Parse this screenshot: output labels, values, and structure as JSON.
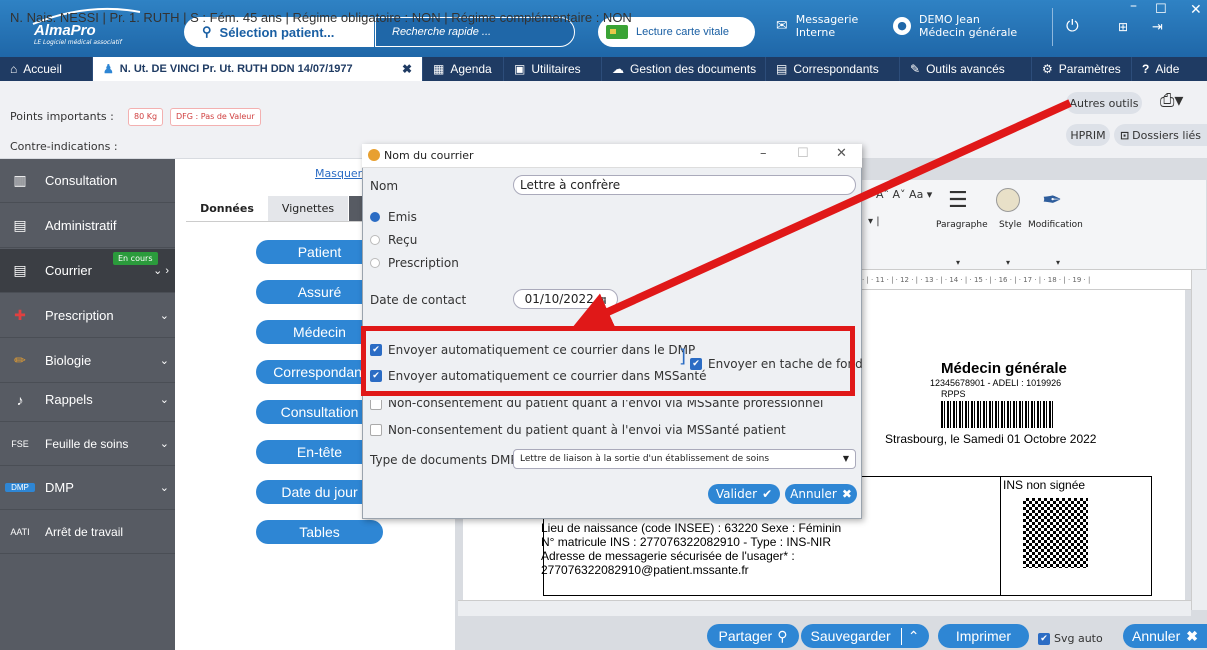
{
  "topbar": {
    "logo_text": "AlmaPro",
    "logo_sub": "LE Logiciel médical associatif",
    "select_patient": "Sélection patient...",
    "quick_search": "Recherche rapide ...",
    "carte_vitale": "Lecture carte vitale",
    "messagerie_1": "Messagerie",
    "messagerie_2": "Interne",
    "user_name": "DEMO Jean",
    "user_role": "Médecin générale"
  },
  "navbar": {
    "home": "Accueil",
    "patient": "N. Ut. DE VINCI Pr. Ut. RUTH DDN 14/07/1977",
    "agenda": "Agenda",
    "utilitaires": "Utilitaires",
    "documents": "Gestion des documents",
    "correspondants": "Correspondants",
    "outils": "Outils avancés",
    "parametres": "Paramètres",
    "aide": "Aide"
  },
  "patient_info": {
    "line": "N. Nais. NESSI | Pr. 1. RUTH | S : Fém. 45 ans | Régime obligatoire : NON | Régime complémentaire : NON",
    "points_label": "Points importants :",
    "badge_weight": "80 Kg",
    "badge_dfg": "DFG : Pas de Valeur",
    "contre_label": "Contre-indications :",
    "autres_outils": "Autres outils",
    "hprim": "HPRIM",
    "dossiers_lies": "Dossiers liés"
  },
  "sidebar": {
    "items": [
      {
        "label": "Consultation"
      },
      {
        "label": "Administratif"
      },
      {
        "label": "Courrier"
      },
      {
        "label": "Prescription"
      },
      {
        "label": "Biologie"
      },
      {
        "label": "Rappels"
      },
      {
        "label": "Feuille de soins",
        "prefix": "FSE"
      },
      {
        "label": "DMP",
        "prefix": "DMP"
      },
      {
        "label": "Arrêt de travail",
        "prefix": "AATI"
      }
    ],
    "en_cours": "En cours"
  },
  "middle": {
    "masquer": "Masquer",
    "tab_donnees": "Données",
    "tab_vignettes": "Vignettes",
    "buttons": [
      "Patient",
      "Assuré",
      "Médecin",
      "Correspondant",
      "Consultation",
      "En-tête",
      "Date du jour",
      "Tables"
    ]
  },
  "ribbon": {
    "paragraphe": "Paragraphe",
    "style": "Style",
    "modification": "Modification",
    "ruler": "· | · 11 · | · 12 · | · 13 · | · 14 · | · 15 · | · 16 · | · 17 · | · 18 · | · 19 · |"
  },
  "document": {
    "medecin": "Médecin générale",
    "ids": "12345678901 - ADELI : 1019926",
    "rpps": "RPPS",
    "date": "Strasbourg, le Samedi 01 Octobre 2022",
    "ins_label": "INS non signée",
    "line1": "Lieu de naissance (code INSEE) : 63220 Sexe : Féminin",
    "line2": "N° matricule INS : 277076322082910 - Type : INS-NIR",
    "line3": "Adresse de messagerie sécurisée de l'usager* :",
    "line4": "277076322082910@patient.mssante.fr"
  },
  "bottom": {
    "partager": "Partager",
    "sauvegarder": "Sauvegarder",
    "imprimer": "Imprimer",
    "svg_auto": "Svg auto",
    "annuler": "Annuler"
  },
  "dialog": {
    "title": "Nom du courrier",
    "nom_label": "Nom",
    "nom_value": "Lettre à confrère",
    "radio_emis": "Emis",
    "radio_recu": "Reçu",
    "radio_prescription": "Prescription",
    "date_label": "Date de contact",
    "date_value": "01/10/2022",
    "chk_dmp": "Envoyer automatiquement ce courrier dans le DMP",
    "chk_mss": "Envoyer automatiquement ce courrier dans MSSanté",
    "chk_tache": "Envoyer en tache de fond",
    "chk_noncons_pro": "Non-consentement du patient quant à l'envoi via MSSanté professionnel",
    "chk_noncons_pat": "Non-consentement du patient quant à l'envoi via MSSanté patient",
    "type_label": "Type de documents DMP",
    "type_value": "Lettre de liaison à la sortie d'un établissement de soins",
    "valider": "Valider",
    "annuler": "Annuler"
  },
  "colors": {
    "accent": "#2e86d4",
    "nav": "#1f3b63",
    "highlight": "#e01818"
  }
}
